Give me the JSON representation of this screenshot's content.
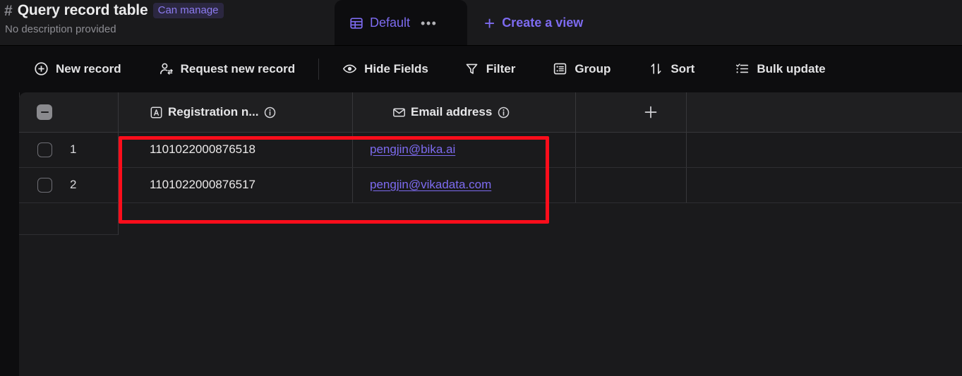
{
  "header": {
    "hash_icon": "hash-icon",
    "title": "Query record table",
    "permission_badge": "Can manage",
    "description": "No description provided"
  },
  "tabs": {
    "active": {
      "label": "Default",
      "icon": "grid-table-icon",
      "more_label": "•••"
    },
    "create_view": {
      "label": "Create a view",
      "icon": "plus-icon"
    }
  },
  "toolbar": {
    "items": [
      {
        "label": "New record",
        "icon": "plus-circle-icon"
      },
      {
        "label": "Request new record",
        "icon": "person-add-icon"
      },
      {
        "label": "Hide Fields",
        "icon": "eye-icon"
      },
      {
        "label": "Filter",
        "icon": "funnel-icon"
      },
      {
        "label": "Group",
        "icon": "group-list-icon"
      },
      {
        "label": "Sort",
        "icon": "sort-arrows-icon"
      },
      {
        "label": "Bulk update",
        "icon": "bulk-list-icon"
      }
    ]
  },
  "grid": {
    "select_all_icon": "indeterminate-checkbox-icon",
    "add_column_icon": "plus-icon",
    "columns": [
      {
        "label": "Registration n...",
        "field_icon": "text-field-icon",
        "info_icon": "info-icon"
      },
      {
        "label": "Email address",
        "field_icon": "email-field-icon",
        "info_icon": "info-icon"
      }
    ],
    "rows": [
      {
        "num": "1",
        "registration": "1101022000876518",
        "email": "pengjin@bika.ai"
      },
      {
        "num": "2",
        "registration": "1101022000876517",
        "email": "pengjin@vikadata.com"
      }
    ]
  },
  "annotation": {
    "highlight_color": "#fc0d1b",
    "highlight_name": "red-rectangle-highlight"
  },
  "colors": {
    "accent_purple": "#7d6bf0",
    "topbar_bg": "#1a1a1c",
    "canvas_bg": "#0d0d0f",
    "grid_header_bg": "#1f1f21",
    "row_bg": "#1a1a1c"
  }
}
